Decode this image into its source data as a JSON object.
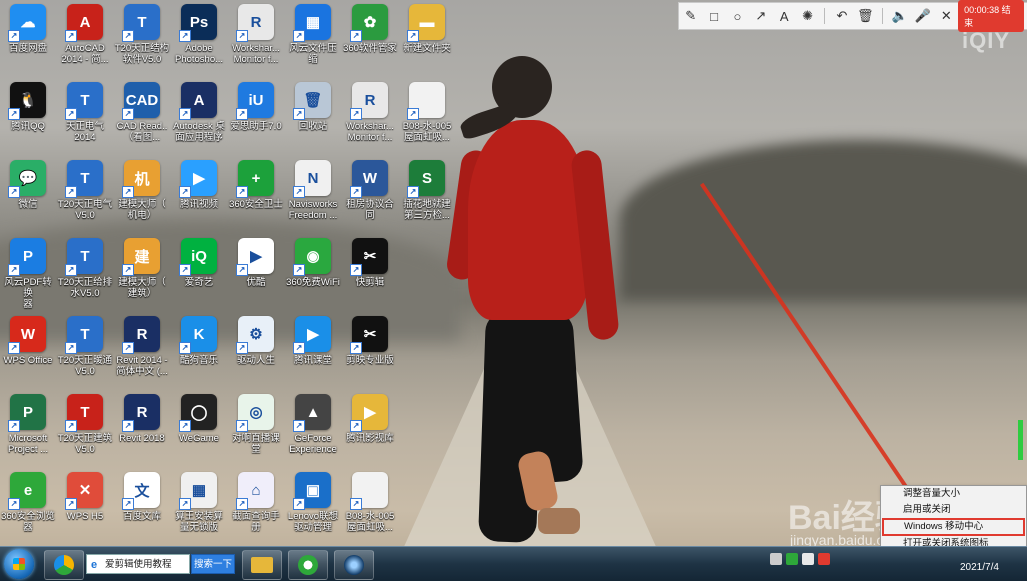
{
  "desktop_icons": [
    {
      "label": "百度网盘",
      "color": "#1f8ef1",
      "glyph": "☁"
    },
    {
      "label": "AutoCAD\n2014 - 简...",
      "color": "#c8221a",
      "glyph": "A"
    },
    {
      "label": "T20天正结构\n软件V5.0",
      "color": "#2a6fc9",
      "glyph": "T"
    },
    {
      "label": "Adobe\nPhotosho...",
      "color": "#0b2d58",
      "glyph": "Ps"
    },
    {
      "label": "Workshar...\nMonitor f...",
      "color": "#e8e8e8",
      "glyph": "R"
    },
    {
      "label": "风云文件压\n缩",
      "color": "#1a74e0",
      "glyph": "▦"
    },
    {
      "label": "360软件管家",
      "color": "#2b9b3f",
      "glyph": "✿"
    },
    {
      "label": "新建文件夹",
      "color": "#e6b73a",
      "glyph": "▬"
    },
    {
      "label": "腾讯QQ",
      "color": "#111",
      "glyph": "🐧"
    },
    {
      "label": "天正电气\n2014",
      "color": "#2a6fc9",
      "glyph": "T"
    },
    {
      "label": "CAD Read..\n（看图...",
      "color": "#1f5fab",
      "glyph": "CAD"
    },
    {
      "label": "Autodesk 桌\n面应用程序",
      "color": "#1a2f64",
      "glyph": "A"
    },
    {
      "label": "爱思助手7.0",
      "color": "#1f7ae0",
      "glyph": "iU"
    },
    {
      "label": "回收站",
      "color": "#b9c7d6",
      "glyph": "🗑"
    },
    {
      "label": "Workshar...\nMonitor f...",
      "color": "#e8e8e8",
      "glyph": "R"
    },
    {
      "label": "B08-水-005\n屋面虹吸...",
      "color": "#f2f2f2",
      "glyph": ""
    },
    {
      "label": "微信",
      "color": "#2aae67",
      "glyph": "💬"
    },
    {
      "label": "T20天正电气\nV5.0",
      "color": "#2a6fc9",
      "glyph": "T"
    },
    {
      "label": "建模大师（\n机电）",
      "color": "#e8a032",
      "glyph": "机"
    },
    {
      "label": "腾讯视频",
      "color": "#2aa0ff",
      "glyph": "▶"
    },
    {
      "label": "360安全卫士",
      "color": "#1ca13b",
      "glyph": "+"
    },
    {
      "label": "Navisworks\nFreedom ...",
      "color": "#f0f0f0",
      "glyph": "N"
    },
    {
      "label": "租房协议合\n同",
      "color": "#2b579a",
      "glyph": "W"
    },
    {
      "label": "插花地就建\n第三方检...",
      "color": "#1d7d3a",
      "glyph": "S"
    },
    {
      "label": "风云PDF转换\n器",
      "color": "#1b7de2",
      "glyph": "P"
    },
    {
      "label": "T20天正给排\n水V5.0",
      "color": "#2a6fc9",
      "glyph": "T"
    },
    {
      "label": "建模大师（\n建筑）",
      "color": "#e8a032",
      "glyph": "建"
    },
    {
      "label": "爱奇艺",
      "color": "#00b140",
      "glyph": "iQ"
    },
    {
      "label": "优酷",
      "color": "#fff",
      "glyph": "▶"
    },
    {
      "label": "360免费WiFi",
      "color": "#2aa83f",
      "glyph": "◉"
    },
    {
      "label": "快剪辑",
      "color": "#111",
      "glyph": "✂"
    },
    {
      "label": "WPS Office",
      "color": "#d7291b",
      "glyph": "W"
    },
    {
      "label": "T20天正暖通\nV5.0",
      "color": "#2a6fc9",
      "glyph": "T"
    },
    {
      "label": "Revit 2014 -\n简体中文 (...",
      "color": "#1a2f64",
      "glyph": "R"
    },
    {
      "label": "酷狗音乐",
      "color": "#1a8fe8",
      "glyph": "K"
    },
    {
      "label": "驱动人生",
      "color": "#e8f0f8",
      "glyph": "⚙"
    },
    {
      "label": "腾讯课堂",
      "color": "#1a8fe8",
      "glyph": "▶"
    },
    {
      "label": "剪映专业版",
      "color": "#111",
      "glyph": "✂"
    },
    {
      "label": "Microsoft\nProject ...",
      "color": "#217346",
      "glyph": "P"
    },
    {
      "label": "T20天正建筑\nV5.0",
      "color": "#c8221a",
      "glyph": "T"
    },
    {
      "label": "Revit 2018",
      "color": "#1a2f64",
      "glyph": "R"
    },
    {
      "label": "WeGame",
      "color": "#222",
      "glyph": "◯"
    },
    {
      "label": "对啊直播课\n堂",
      "color": "#e8f4ea",
      "glyph": "◎"
    },
    {
      "label": "GeForce\nExperience",
      "color": "#444",
      "glyph": "▲"
    },
    {
      "label": "腾讯影视库",
      "color": "#e6b73a",
      "glyph": "▶"
    },
    {
      "label": "360安全浏览\n器",
      "color": "#2ea83a",
      "glyph": "e"
    },
    {
      "label": "WPS H5",
      "color": "#e04c3a",
      "glyph": "✕"
    },
    {
      "label": "百度文库",
      "color": "#fff",
      "glyph": "文"
    },
    {
      "label": "算王安装算\n量无锁版",
      "color": "#f0f0f0",
      "glyph": "▦"
    },
    {
      "label": "截面查询手\n册",
      "color": "#f0eefa",
      "glyph": "⌂"
    },
    {
      "label": "Lenovo联想\n驱动管理",
      "color": "#1a6fc9",
      "glyph": "▣"
    },
    {
      "label": "B08-水-005\n屋面虹吸...",
      "color": "#f2f2f2",
      "glyph": ""
    }
  ],
  "annotation_toolbar": {
    "tools": [
      {
        "name": "pen-icon",
        "glyph": "✎"
      },
      {
        "name": "rectangle-icon",
        "glyph": "□"
      },
      {
        "name": "ellipse-icon",
        "glyph": "○"
      },
      {
        "name": "arrow-tool-icon",
        "glyph": "↗"
      },
      {
        "name": "text-tool-icon",
        "glyph": "A"
      },
      {
        "name": "highlighter-icon",
        "glyph": "✺"
      },
      {
        "name": "undo-icon",
        "glyph": "↶"
      },
      {
        "name": "delete-icon",
        "glyph": "🗑"
      },
      {
        "name": "speaker-icon",
        "glyph": "🔈"
      },
      {
        "name": "microphone-icon",
        "glyph": "🎤"
      },
      {
        "name": "close-icon",
        "glyph": "✕"
      }
    ],
    "recording_label": "00:00:38 结束"
  },
  "watermarks": {
    "iqiyi": "iQIY",
    "baidu": "Bai经验",
    "baidu_url": "jingyan.baidu.com"
  },
  "context_menu": {
    "items": [
      {
        "label": "调整音量大小"
      },
      {
        "label": "启用或关闭"
      },
      {
        "label": "Windows 移动中心"
      },
      {
        "label": "打开或关闭系统图标"
      }
    ]
  },
  "taskbar": {
    "search_placeholder": "爱剪辑使用教程",
    "search_button": "搜索一下",
    "clock_date": "2021/7/4"
  },
  "colors": {
    "accent_red": "#e03a2f",
    "taskbar": "#1e3344",
    "search_blue": "#2e7fe0"
  }
}
